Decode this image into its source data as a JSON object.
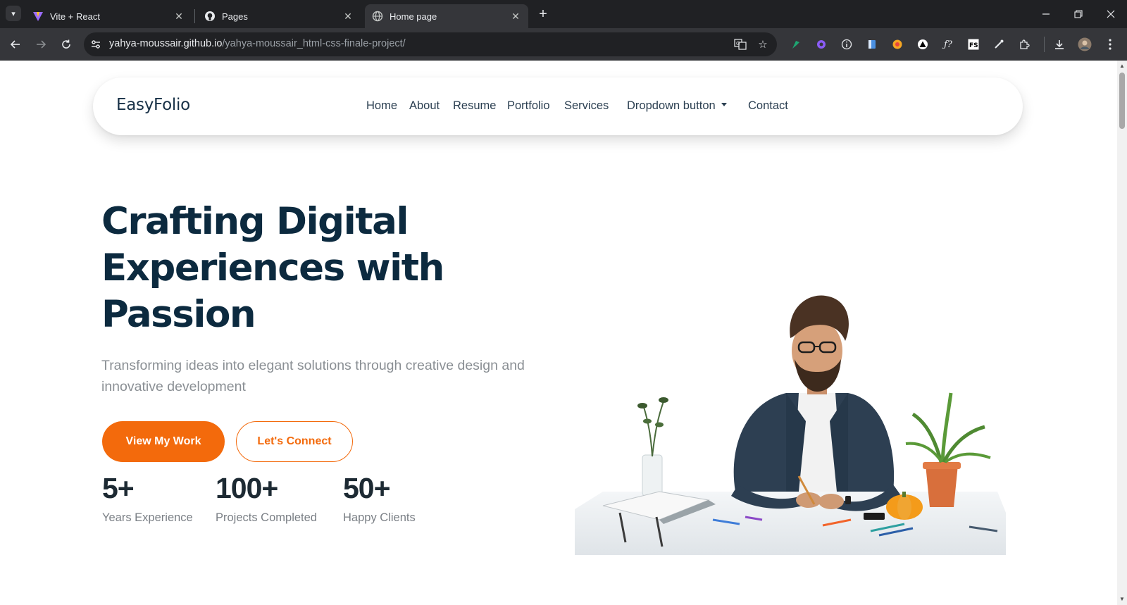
{
  "browser": {
    "tabs": [
      {
        "title": "Vite + React",
        "icon": "vite-logo-icon",
        "active": false
      },
      {
        "title": "Pages",
        "icon": "github-icon",
        "active": false
      },
      {
        "title": "Home page",
        "icon": "globe-icon",
        "active": true
      }
    ],
    "url_host": "yahya-moussair.github.io",
    "url_path": "/yahya-moussair_html-css-finale-project/"
  },
  "site": {
    "logo": "EasyFolio",
    "nav": {
      "home": "Home",
      "about": "About",
      "resume": "Resume",
      "portfolio": "Portfolio",
      "services": "Services",
      "dropdown": "Dropdown button",
      "contact": "Contact"
    }
  },
  "hero": {
    "title_lines": [
      "Crafting Digital",
      "Experiences with",
      "Passion"
    ],
    "subtitle": "Transforming ideas into elegant solutions through creative design and innovative development",
    "primary_button": "View My Work",
    "secondary_button": "Let's Connect"
  },
  "stats": [
    {
      "value": "5+",
      "label": "Years Experience"
    },
    {
      "value": "100+",
      "label": "Projects Completed"
    },
    {
      "value": "50+",
      "label": "Happy Clients"
    }
  ],
  "colors": {
    "accent": "#f36a0c",
    "heading": "#0c2a3f",
    "chrome_dark": "#202124"
  }
}
